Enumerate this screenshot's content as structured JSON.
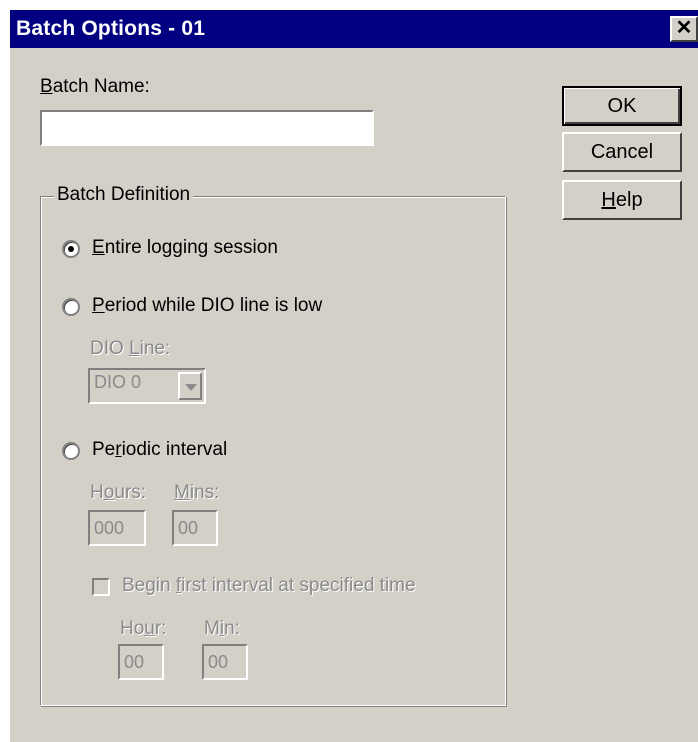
{
  "window": {
    "title": "Batch Options - 01",
    "close_glyph": "✕"
  },
  "batch_name": {
    "label_mnemonic": "B",
    "label_rest": "atch Name:",
    "value": ""
  },
  "buttons": {
    "ok": "OK",
    "cancel": "Cancel",
    "help_mnemonic": "H",
    "help_rest": "elp"
  },
  "batch_definition": {
    "title": "Batch Definition",
    "selected": "entire",
    "entire": {
      "mnemonic": "E",
      "rest": "ntire logging session"
    },
    "period": {
      "mnemonic": "P",
      "rest": "eriod while DIO line is low"
    },
    "dio_line": {
      "label_prefix": "DIO ",
      "label_mnemonic": "L",
      "label_rest": "ine:",
      "value": "DIO 0"
    },
    "periodic": {
      "prefix": "Pe",
      "mnemonic": "r",
      "rest": "iodic interval"
    },
    "hours": {
      "label_prefix": "H",
      "label_mnemonic": "o",
      "label_rest": "urs:",
      "value": "000"
    },
    "mins": {
      "label_mnemonic": "M",
      "label_rest": "ins:",
      "value": "00"
    },
    "begin_first": {
      "prefix": "Begin ",
      "mnemonic": "f",
      "rest": "irst interval at specified time",
      "checked": false
    },
    "hour": {
      "label_prefix": "Ho",
      "label_mnemonic": "u",
      "label_rest": "r:",
      "value": "00"
    },
    "min": {
      "label_prefix": "M",
      "label_mnemonic": "i",
      "label_rest": "n:",
      "value": "00"
    }
  }
}
